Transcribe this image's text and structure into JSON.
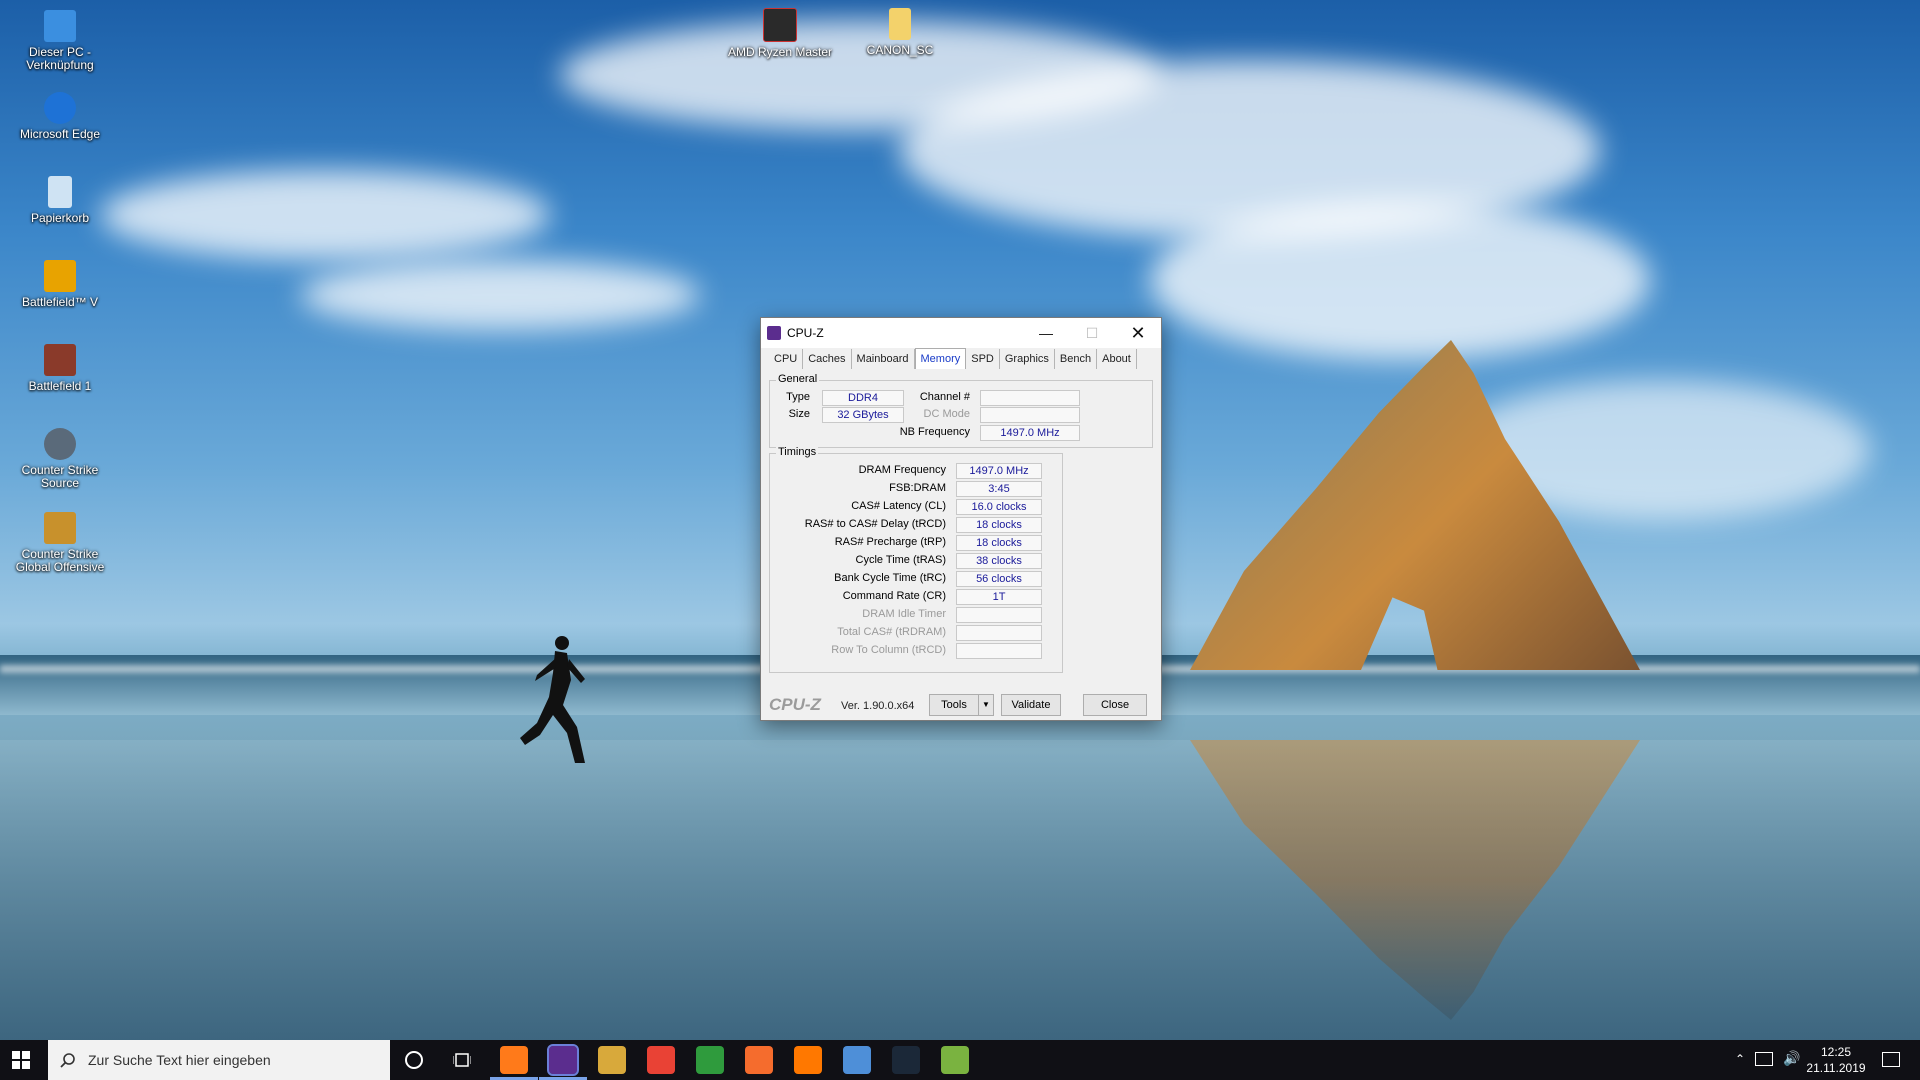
{
  "desktop": {
    "icons": [
      {
        "label": "Dieser PC - Verknüpfung",
        "icon": "this-pc-icon",
        "color": "#3b8fe0"
      },
      {
        "label": "Microsoft Edge",
        "icon": "edge-icon",
        "color": "#1e72d6"
      },
      {
        "label": "Papierkorb",
        "icon": "recycle-bin-icon",
        "color": "#cfe3f3"
      },
      {
        "label": "Battlefield™ V",
        "icon": "battlefield-v-icon",
        "color": "#e8a300"
      },
      {
        "label": "Battlefield 1",
        "icon": "battlefield-1-icon",
        "color": "#8a3a2a"
      },
      {
        "label": "Counter Strike Source",
        "icon": "cs-source-icon",
        "color": "#5a6a7a"
      },
      {
        "label": "Counter Strike Global Offensive",
        "icon": "csgo-icon",
        "color": "#c8912c"
      },
      {
        "label": "AMD Ryzen Master",
        "icon": "ryzen-master-icon",
        "color": "#2a2a2a"
      },
      {
        "label": "CANON_SC",
        "icon": "folder-icon",
        "color": "#f3d26b"
      }
    ]
  },
  "cpuz": {
    "title": "CPU-Z",
    "tabs": [
      "CPU",
      "Caches",
      "Mainboard",
      "Memory",
      "SPD",
      "Graphics",
      "Bench",
      "About"
    ],
    "active_tab": "Memory",
    "general": {
      "label": "General",
      "type_label": "Type",
      "type_value": "DDR4",
      "size_label": "Size",
      "size_value": "32 GBytes",
      "channel_label": "Channel #",
      "channel_value": "",
      "dcmode_label": "DC Mode",
      "dcmode_value": "",
      "nbfreq_label": "NB Frequency",
      "nbfreq_value": "1497.0 MHz"
    },
    "timings": {
      "label": "Timings",
      "rows": [
        {
          "label": "DRAM Frequency",
          "value": "1497.0 MHz",
          "dim": false
        },
        {
          "label": "FSB:DRAM",
          "value": "3:45",
          "dim": false
        },
        {
          "label": "CAS# Latency (CL)",
          "value": "16.0 clocks",
          "dim": false
        },
        {
          "label": "RAS# to CAS# Delay (tRCD)",
          "value": "18 clocks",
          "dim": false
        },
        {
          "label": "RAS# Precharge (tRP)",
          "value": "18 clocks",
          "dim": false
        },
        {
          "label": "Cycle Time (tRAS)",
          "value": "38 clocks",
          "dim": false
        },
        {
          "label": "Bank Cycle Time (tRC)",
          "value": "56 clocks",
          "dim": false
        },
        {
          "label": "Command Rate (CR)",
          "value": "1T",
          "dim": false
        },
        {
          "label": "DRAM Idle Timer",
          "value": "",
          "dim": true
        },
        {
          "label": "Total CAS# (tRDRAM)",
          "value": "",
          "dim": true
        },
        {
          "label": "Row To Column (tRCD)",
          "value": "",
          "dim": true
        }
      ]
    },
    "footer": {
      "logo": "CPU-Z",
      "version": "Ver. 1.90.0.x64",
      "tools_label": "Tools",
      "validate_label": "Validate",
      "close_label": "Close"
    }
  },
  "taskbar": {
    "search_placeholder": "Zur Suche Text hier eingeben",
    "apps": [
      {
        "icon": "firefox-icon",
        "color": "#ff7a1a"
      },
      {
        "icon": "cpuz-icon",
        "color": "#5b2d8e"
      },
      {
        "icon": "app-icon",
        "color": "#d8a93b"
      },
      {
        "icon": "chrome-icon",
        "color": "#e94235"
      },
      {
        "icon": "xbox-icon",
        "color": "#2f9b3d"
      },
      {
        "icon": "origin-icon",
        "color": "#f56c2d"
      },
      {
        "icon": "avast-icon",
        "color": "#ff7800"
      },
      {
        "icon": "calendar-icon",
        "color": "#4e8fd8"
      },
      {
        "icon": "steam-icon",
        "color": "#1b2838"
      },
      {
        "icon": "gpu-icon",
        "color": "#7ab340"
      }
    ],
    "time": "12:25",
    "date": "21.11.2019"
  }
}
